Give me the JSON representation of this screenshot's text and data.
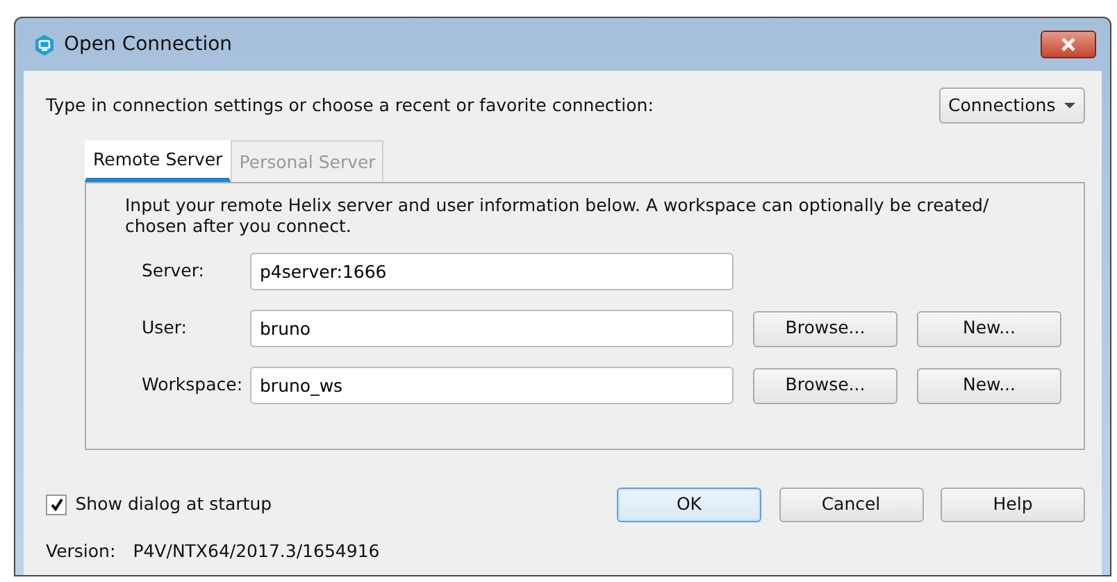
{
  "window": {
    "title": "Open Connection"
  },
  "intro": "Type in connection settings or choose a recent or favorite connection:",
  "connections_button": "Connections",
  "tabs": [
    {
      "label": "Remote Server",
      "selected": true
    },
    {
      "label": "Personal Server",
      "selected": false
    }
  ],
  "panel": {
    "description": "Input your remote Helix server and user information below. A workspace can optionally be created/ chosen after you connect.",
    "fields": [
      {
        "label": "Server:",
        "value": "p4server:1666"
      },
      {
        "label": "User:",
        "value": "bruno",
        "buttons": [
          "Browse...",
          "New..."
        ]
      },
      {
        "label": "Workspace:",
        "value": "bruno_ws",
        "buttons": [
          "Browse...",
          "New..."
        ]
      }
    ]
  },
  "show_dialog": {
    "label": "Show dialog at startup",
    "checked": true
  },
  "buttons": [
    {
      "label": "OK",
      "default": true
    },
    {
      "label": "Cancel",
      "default": false
    },
    {
      "label": "Help",
      "default": false
    }
  ],
  "version": {
    "label": "Version:",
    "value": "P4V/NTX64/2017.3/1654916"
  }
}
